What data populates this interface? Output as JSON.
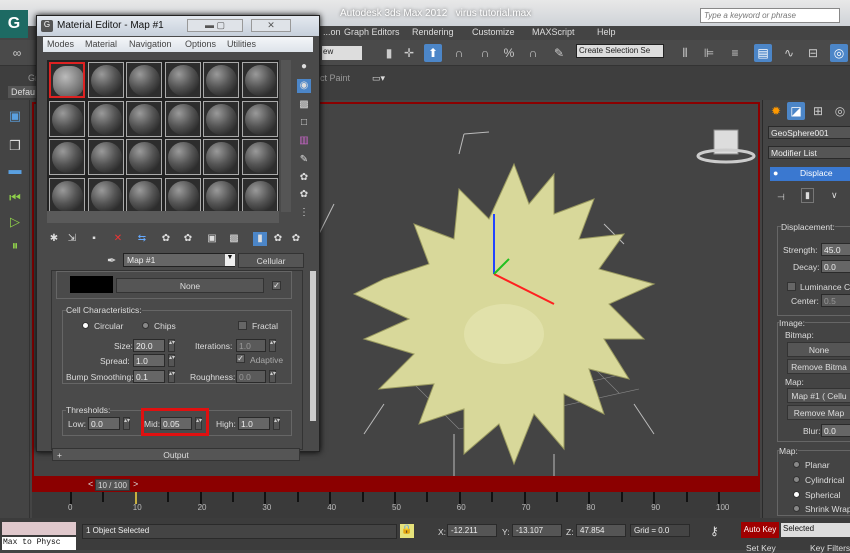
{
  "app": {
    "title": "Autodesk 3ds Max  2012",
    "file": "virus tutorial.max",
    "search_placeholder": "Type a keyword or phrase"
  },
  "menu": [
    "...on",
    "Graph Editors",
    "Rendering",
    "Customize",
    "MAXScript",
    "Help"
  ],
  "toolbar": {
    "view_dropdown": "ew",
    "selection_set": "Create Selection Se"
  },
  "ribbon": {
    "tab_left": "Gr",
    "tab_right": "ct Paint",
    "default_label": "Defau"
  },
  "material_editor": {
    "title": "Material Editor - Map #1",
    "menu": [
      "Modes",
      "Material",
      "Navigation",
      "Options",
      "Utilities"
    ],
    "map_name": "Map #1",
    "map_type": "Cellular",
    "none_button": "None",
    "cell_characteristics": {
      "label": "Cell Characteristics:",
      "circular": "Circular",
      "chips": "Chips",
      "selected": "Circular",
      "fractal": "Fractal",
      "fractal_checked": false,
      "size_label": "Size:",
      "size": "20.0",
      "spread_label": "Spread:",
      "spread": "1.0",
      "bump_label": "Bump Smoothing:",
      "bump": "0.1",
      "iterations_label": "Iterations:",
      "iterations": "1.0",
      "adaptive": "Adaptive",
      "adaptive_checked": true,
      "roughness_label": "Roughness:",
      "roughness": "0.0"
    },
    "thresholds": {
      "label": "Thresholds:",
      "low_label": "Low:",
      "low": "0.0",
      "mid_label": "Mid:",
      "mid": "0.05",
      "high_label": "High:",
      "high": "1.0"
    },
    "output_rollout": "Output",
    "output_plus": "+"
  },
  "command_panel": {
    "object_name": "GeoSphere001",
    "modifier_list": "Modifier List",
    "modifier": "Displace",
    "displacement": {
      "label": "Displacement:",
      "strength_label": "Strength:",
      "strength": "45.0",
      "decay_label": "Decay:",
      "decay": "0.0",
      "luminance": "Luminance Cer",
      "center_label": "Center:",
      "center": "0.5"
    },
    "image": {
      "label": "Image:",
      "bitmap_label": "Bitmap:",
      "bitmap_button": "None",
      "remove_bitmap": "Remove Bitma",
      "map_label": "Map:",
      "map_button": "Map #1  ( Cellu",
      "remove_map": "Remove Map",
      "blur_label": "Blur:",
      "blur": "0.0"
    },
    "map": {
      "label": "Map:",
      "options": [
        "Planar",
        "Cylindrical",
        "Spherical",
        "Shrink Wrap"
      ],
      "selected": "Spherical"
    }
  },
  "timeline": {
    "slider": "10 / 100",
    "current_frame": 10,
    "total": 100,
    "ticks": [
      "0",
      "10",
      "20",
      "30",
      "40",
      "50",
      "60",
      "70",
      "80",
      "90",
      "100"
    ],
    "prev": "<",
    "next": ">"
  },
  "status": {
    "script_label": "Max to Physc",
    "selection": "1 Object Selected",
    "x_label": "X:",
    "x": "-12.211",
    "y_label": "Y:",
    "y": "-13.107",
    "z_label": "Z:",
    "z": "47.854",
    "grid": "Grid = 0.0",
    "auto_key": "Auto Key",
    "key_mode": "Selected",
    "set_key": "Set Key",
    "key_filters": "Key Filters"
  },
  "colors": {
    "viewport_border": "#8b0000",
    "accent": "#4c86c8",
    "virus": "#d8d89a",
    "autokey": "#a00000"
  }
}
